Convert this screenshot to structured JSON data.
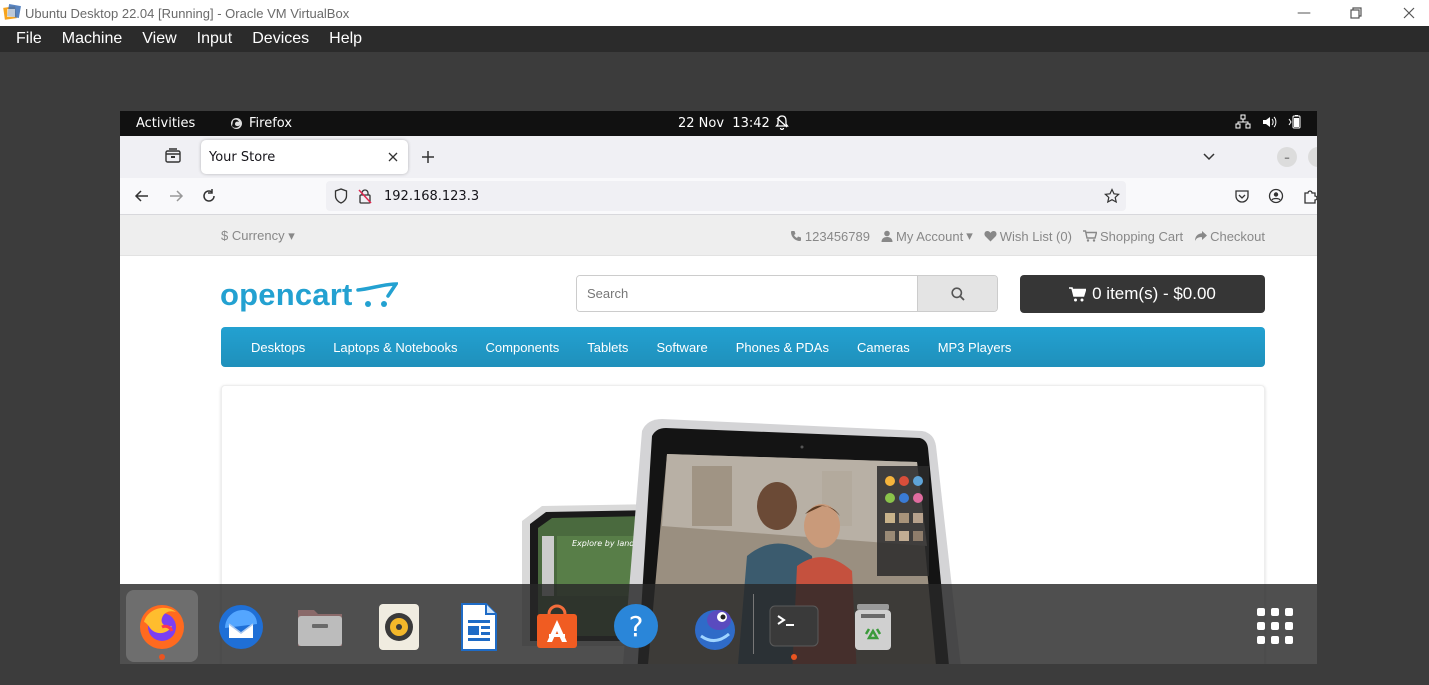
{
  "vbox": {
    "title": "Ubuntu Desktop 22.04 [Running] - Oracle VM VirtualBox",
    "menu": [
      "File",
      "Machine",
      "View",
      "Input",
      "Devices",
      "Help"
    ]
  },
  "gnome": {
    "activities": "Activities",
    "app_name": "Firefox",
    "clock": "22 Nov  13:42"
  },
  "firefox": {
    "tab_title": "Your Store",
    "url": "192.168.123.3"
  },
  "store": {
    "currency": "$ Currency",
    "phone": "123456789",
    "my_account": "My Account",
    "wish_list": "Wish List (0)",
    "shopping_cart": "Shopping Cart",
    "checkout": "Checkout",
    "logo": "opencart",
    "search_placeholder": "Search",
    "cart_button": "0 item(s) - $0.00",
    "menu": [
      "Desktops",
      "Laptops & Notebooks",
      "Components",
      "Tablets",
      "Software",
      "Phones & PDAs",
      "Cameras",
      "MP3 Players"
    ],
    "slide_caption": "Explore by land."
  },
  "dock": {
    "apps": [
      "Firefox",
      "Thunderbird",
      "Files",
      "Rhythmbox",
      "LibreOffice Writer",
      "Ubuntu Software",
      "Help",
      "Remmina",
      "Terminal",
      "Trash",
      "Show Applications"
    ]
  },
  "colors": {
    "oc_blue": "#23a1d1",
    "cart_dark": "#363636",
    "ubuntu_orange": "#e95420"
  }
}
